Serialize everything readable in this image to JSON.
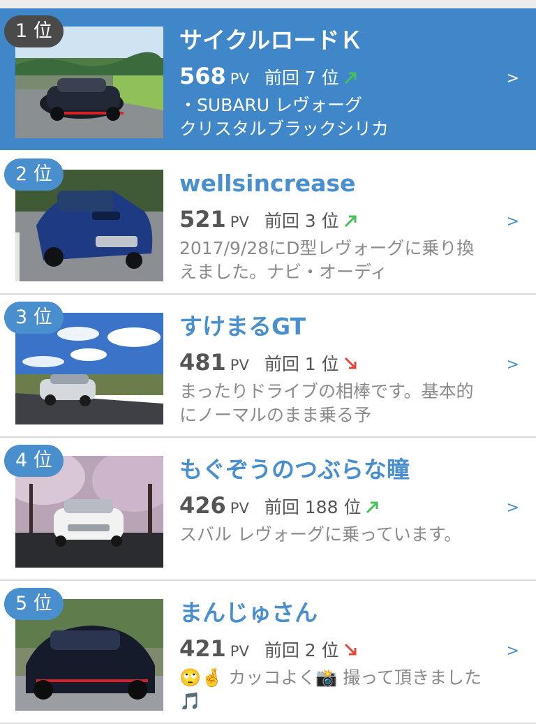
{
  "colors": {
    "accent": "#4a8fcd",
    "first_bg": "#3f87c8",
    "up_arrow": "#46c057",
    "down_arrow": "#e04a3a"
  },
  "rankings": [
    {
      "rank": "1 位",
      "name": "サイクルロードＫ",
      "pv": "568",
      "pv_unit": "PV",
      "previous": "前回 7 位",
      "trend": "up",
      "description": "・SUBARU レヴォーグ\nクリスタルブラックシリカ",
      "chevron": ">"
    },
    {
      "rank": "2 位",
      "name": "wellsincrease",
      "pv": "521",
      "pv_unit": "PV",
      "previous": "前回 3 位",
      "trend": "up",
      "description": "2017/9/28にD型レヴォーグに乗り換えました。ナビ・オーディ",
      "chevron": ">"
    },
    {
      "rank": "3 位",
      "name": "すけまるGT",
      "pv": "481",
      "pv_unit": "PV",
      "previous": "前回 1 位",
      "trend": "down",
      "description": "まったりドライブの相棒です。基本的にノーマルのまま乗る予",
      "chevron": ">"
    },
    {
      "rank": "4 位",
      "name": "もぐぞうのつぶらな瞳",
      "pv": "426",
      "pv_unit": "PV",
      "previous": "前回 188 位",
      "trend": "up",
      "description": "スバル レヴォーグに乗っています。",
      "chevron": ">"
    },
    {
      "rank": "5 位",
      "name": "まんじゅさん",
      "pv": "421",
      "pv_unit": "PV",
      "previous": "前回 2 位",
      "trend": "down",
      "description": "🙄🤞 カッコよく📸 撮って頂きました🎵",
      "chevron": ">"
    }
  ]
}
